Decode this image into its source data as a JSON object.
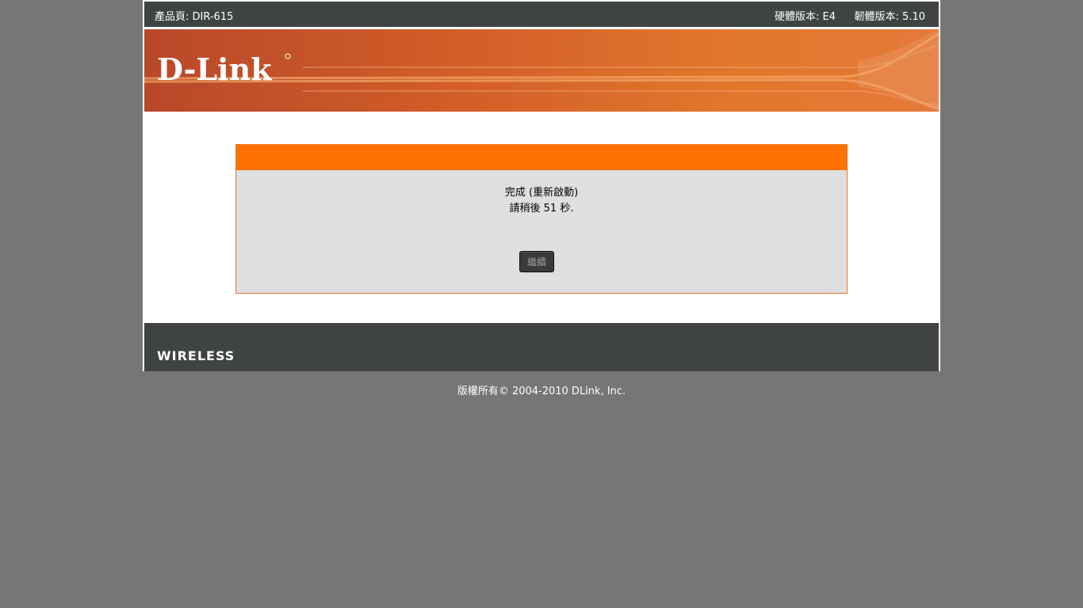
{
  "header": {
    "product_label": "產品頁: DIR-615",
    "hardware_version": "硬體版本: E4",
    "firmware_version": "韌體版本: 5.10"
  },
  "brand": {
    "logo_text": "D-Link",
    "footer_logo_text": "WIRELESS"
  },
  "panel": {
    "title": "",
    "message_line1": "完成 (重新啟動)",
    "message_line2": "請稍後 51 秒.",
    "continue_button": "繼續"
  },
  "footer": {
    "copyright": "版權所有© 2004-2010 DLink, Inc."
  },
  "colors": {
    "page_background": "#767676",
    "header_bar": "#404344",
    "panel_header": "#ff7104",
    "panel_body": "#dfdfdf",
    "banner_orange": "#d35e28"
  }
}
